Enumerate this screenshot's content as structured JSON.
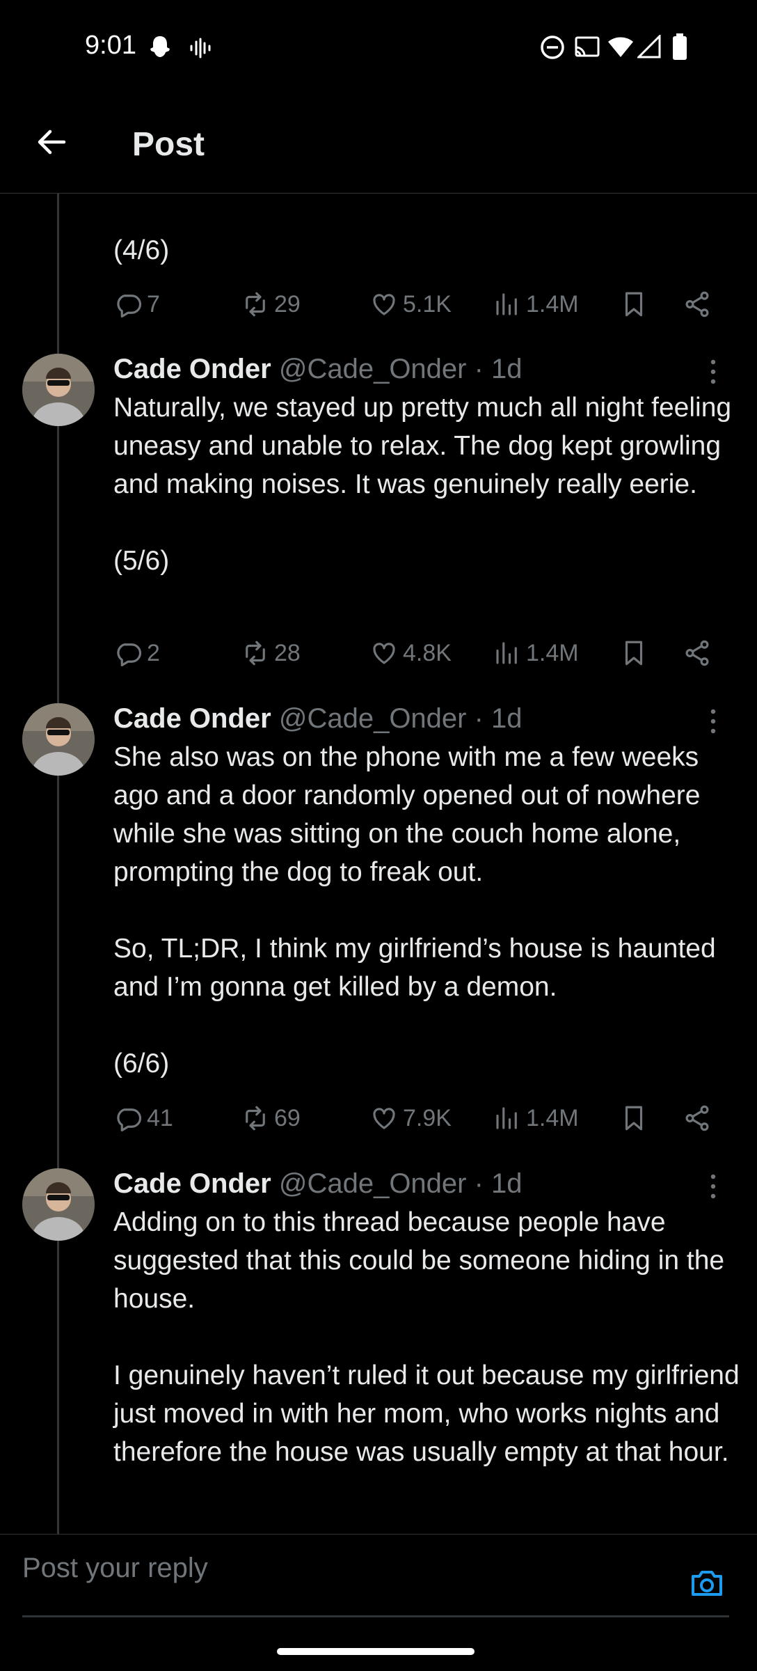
{
  "status_bar": {
    "time": "9:01"
  },
  "app_bar": {
    "title": "Post"
  },
  "posts": [
    {
      "text": "(4/6)",
      "actions": {
        "replies": "7",
        "reposts": "29",
        "likes": "5.1K",
        "views": "1.4M"
      }
    },
    {
      "name": "Cade Onder",
      "handle": "@Cade_Onder · 1d",
      "text": "Naturally, we stayed up pretty much all night feeling uneasy and unable to relax. The dog kept growling and making noises. It was genuinely really eerie.\n\n(5/6)",
      "actions": {
        "replies": "2",
        "reposts": "28",
        "likes": "4.8K",
        "views": "1.4M"
      }
    },
    {
      "name": "Cade Onder",
      "handle": "@Cade_Onder · 1d",
      "text": "She also was on the phone with me a few weeks ago and a door randomly opened out of nowhere while she was sitting on the couch home alone, prompting the dog to freak out.\n\nSo, TL;DR, I think my girlfriend’s house is haunted and I’m gonna get killed by a demon.\n\n(6/6)",
      "actions": {
        "replies": "41",
        "reposts": "69",
        "likes": "7.9K",
        "views": "1.4M"
      }
    },
    {
      "name": "Cade Onder",
      "handle": "@Cade_Onder · 1d",
      "text": "Adding on to this thread because people have suggested that this could be someone hiding in the house.\n\nI genuinely haven’t ruled it out because my girlfriend just moved in with her mom, who works nights and therefore the house was usually empty at that hour."
    }
  ],
  "reply_bar": {
    "placeholder": "Post your reply"
  },
  "colors": {
    "background": "#000000",
    "text": "#e7e9ea",
    "secondary": "#71767b",
    "accent": "#1d9bf0",
    "divider": "#2f3336"
  },
  "icons": [
    "back-arrow-icon",
    "reply-icon",
    "repost-icon",
    "like-icon",
    "views-icon",
    "bookmark-icon",
    "share-icon",
    "more-icon",
    "camera-icon"
  ]
}
